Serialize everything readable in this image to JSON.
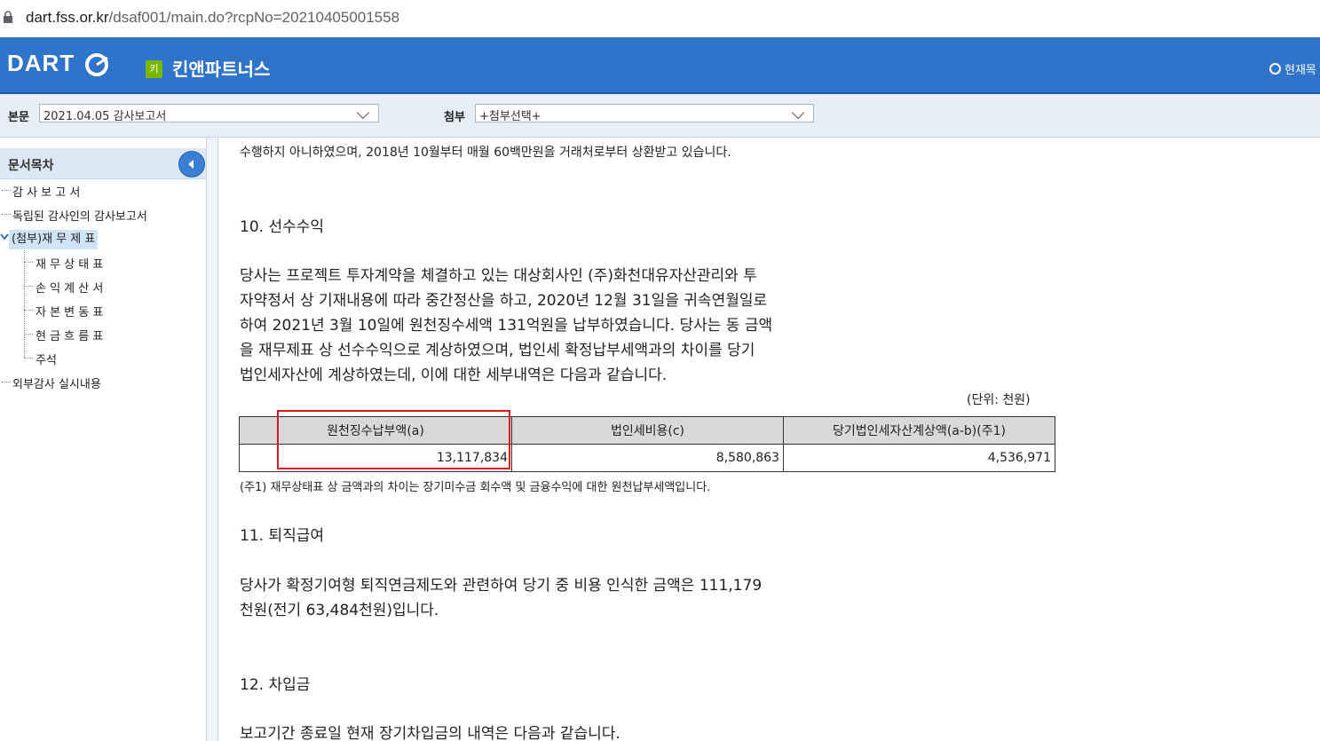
{
  "browser": {
    "url_host": "dart.fss.or.kr",
    "url_path": "/dsaf001/main.do?rcpNo=20210405001558"
  },
  "header": {
    "logo": "DART",
    "company_badge": "키",
    "company_name": "킨앤파트너스",
    "present_label": "현재목"
  },
  "selbar": {
    "main_label": "본문",
    "main_value": "2021.04.05  감사보고서",
    "attach_label": "첨부",
    "attach_value": "+첨부선택+"
  },
  "sidebar": {
    "title": "문서목차",
    "items": [
      "감 사 보 고 서",
      "독립된 감사인의 감사보고서",
      "(첨부)재 무 제 표",
      "재 무 상 태 표",
      "손 익 계 산 서",
      "자 본 변 동 표",
      "현 금 흐 름 표",
      "주석",
      "외부감사 실시내용"
    ]
  },
  "content": {
    "cut_line": "수행하지 아니하였으며, 2018년 10월부터 매월 60백만원을 거래처로부터 상환받고 있습니다.",
    "sec10_title": "10. 선수수익",
    "sec10_lines": [
      "당사는 프로젝트 투자계약을 체결하고 있는 대상회사인 (주)화천대유자산관리와 투",
      "자약정서 상 기재내용에 따라 중간정산을 하고, 2020년 12월 31일을 귀속연월일로",
      "하여 2021년 3월 10일에 원천징수세액 131억원을 납부하였습니다. 당사는 동 금액",
      "을 재무제표 상 선수수익으로 계상하였으며, 법인세 확정납부세액과의 차이를 당기",
      "법인세자산에 계상하였는데, 이에 대한 세부내역은 다음과 같습니다."
    ],
    "unit": "(단위: 천원)",
    "table_headers": [
      "원천징수납부액(a)",
      "법인세비용(c)",
      "당기법인세자산계상액(a-b)(주1)"
    ],
    "table_values": [
      "13,117,834",
      "8,580,863",
      "4,536,971"
    ],
    "note": "(주1) 재무상태표 상 금액과의 차이는 장기미수금 회수액 및 금융수익에 대한 원천납부세액입니다.",
    "sec11_title": "11. 퇴직급여",
    "sec11_lines": [
      "당사가 확정기여형 퇴직연금제도와 관련하여 당기 중 비용 인식한 금액은 111,179",
      "천원(전기 63,484천원)입니다."
    ],
    "sec12_title": "12. 차입금",
    "sec12_line": "보고기간 종료일 현재 장기차입금의 내역은 다음과 같습니다."
  },
  "colors": {
    "header_blue": "#2f74c9",
    "highlight_red": "#e0161d",
    "badge_green": "#7ab800"
  }
}
